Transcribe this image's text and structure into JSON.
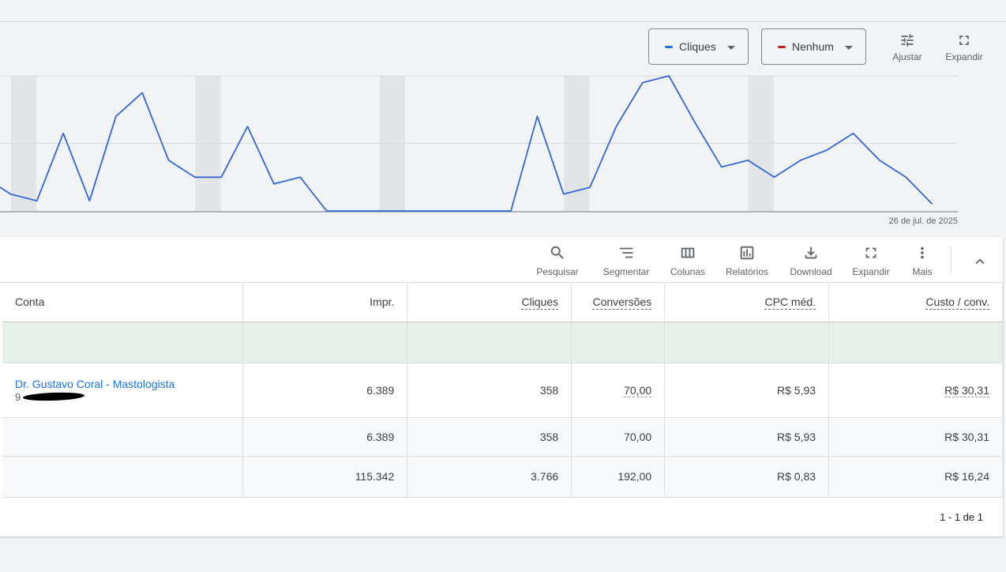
{
  "chart_controls": {
    "metric1": {
      "label": "Cliques",
      "color": "#1a73e8"
    },
    "metric2": {
      "label": "Nenhum",
      "color": "#c5221f"
    },
    "adjust_label": "Ajustar",
    "expand_label": "Expandir"
  },
  "chart_data": {
    "type": "line",
    "series": [
      {
        "values": [
          10,
          5,
          3,
          23,
          3,
          28,
          35,
          15,
          10,
          10,
          25,
          8,
          10,
          0,
          0,
          0,
          0,
          0,
          0,
          0,
          0,
          28,
          5,
          7,
          25,
          38,
          40,
          26,
          13,
          15,
          10,
          15,
          18,
          23,
          15,
          10,
          2
        ],
        "color": "#3367d6"
      }
    ],
    "ylim": [
      0,
      40
    ],
    "grid": true,
    "end_date_label": "26 de jul. de 2025"
  },
  "toolbar": {
    "search": "Pesquisar",
    "segment": "Segmentar",
    "columns": "Colunas",
    "reports": "Relatórios",
    "download": "Download",
    "expand": "Expandir",
    "more": "Mais"
  },
  "table": {
    "headers": {
      "account": "Conta",
      "impr": "Impr.",
      "clicks": "Cliques",
      "conversions": "Conversões",
      "avg_cpc": "CPC méd.",
      "cost_conv": "Custo / conv."
    },
    "row": {
      "account_name": "Dr. Gustavo Coral - Mastologista",
      "account_id": "9",
      "impr": "6.389",
      "clicks": "358",
      "conversions": "70,00",
      "avg_cpc": "R$ 5,93",
      "cost_conv": "R$ 30,31"
    },
    "total1": {
      "impr": "6.389",
      "clicks": "358",
      "conversions": "70,00",
      "avg_cpc": "R$ 5,93",
      "cost_conv": "R$ 30,31"
    },
    "total2": {
      "impr": "115.342",
      "clicks": "3.766",
      "conversions": "192,00",
      "avg_cpc": "R$ 0,83",
      "cost_conv": "R$ 16,24"
    }
  },
  "pagination": "1 - 1 de 1"
}
